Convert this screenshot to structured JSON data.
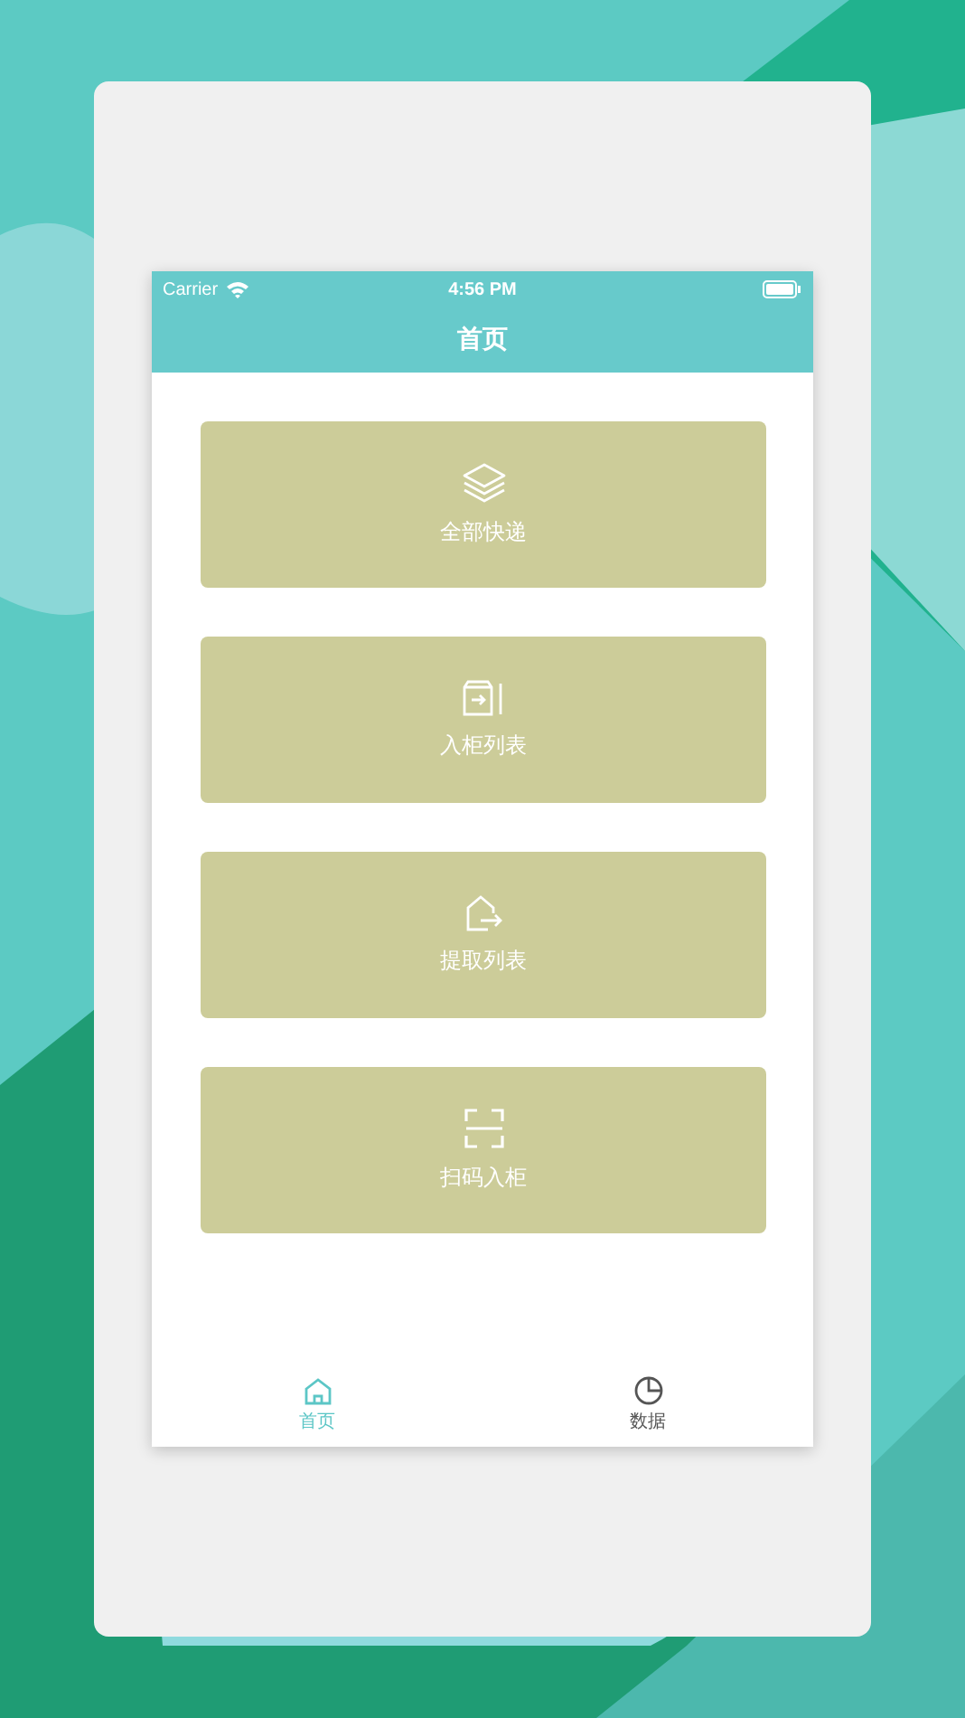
{
  "status_bar": {
    "carrier": "Carrier",
    "time": "4:56 PM"
  },
  "nav_bar": {
    "title": "首页"
  },
  "menu": [
    {
      "label": "全部快递"
    },
    {
      "label": "入柜列表"
    },
    {
      "label": "提取列表"
    },
    {
      "label": "扫码入柜"
    }
  ],
  "tab_bar": [
    {
      "label": "首页",
      "selected": true
    },
    {
      "label": "数据",
      "selected": false
    }
  ]
}
